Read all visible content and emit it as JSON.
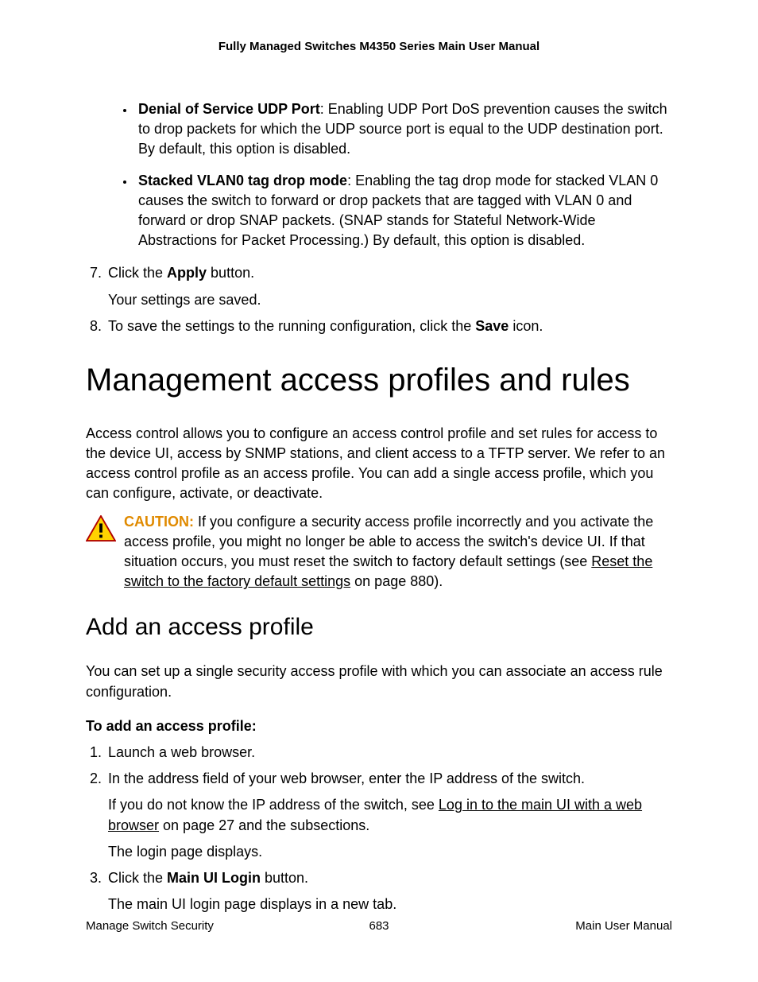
{
  "header_title": "Fully Managed Switches M4350 Series Main User Manual",
  "bullets": [
    {
      "bold": "Denial of Service UDP Port",
      "text": ": Enabling UDP Port DoS prevention causes the switch to drop packets for which the UDP source port is equal to the UDP destination port. By default, this option is disabled."
    },
    {
      "bold": "Stacked VLAN0 tag drop mode",
      "text": ": Enabling the tag drop mode for stacked VLAN 0 causes the switch to forward or drop packets that are tagged with VLAN 0 and forward or drop SNAP packets. (SNAP stands for Stateful Network-Wide Abstractions for Packet Processing.) By default, this option is disabled."
    }
  ],
  "step7": {
    "num": "7.",
    "pre": "Click the ",
    "bold": "Apply",
    "post": " button.",
    "result": "Your settings are saved."
  },
  "step8": {
    "num": "8.",
    "pre": "To save the settings to the running configuration, click the ",
    "bold": "Save",
    "post": " icon."
  },
  "h1": "Management access profiles and rules",
  "intro_para": "Access control allows you to configure an access control profile and set rules for access to the device UI, access by SNMP stations, and client access to a TFTP server. We refer to an access control profile as an access profile. You can add a single access profile, which you can configure, activate, or deactivate.",
  "caution": {
    "label": "CAUTION:",
    "text_pre": " If you configure a security access profile incorrectly and you activate the access profile, you might no longer be able to access the switch's device UI. If that situation occurs, you must reset the switch to factory default settings (see ",
    "link": "Reset the switch to the factory default settings",
    "text_post": " on page 880)."
  },
  "h2": "Add an access profile",
  "h2_intro": "You can set up a single security access profile with which you can associate an access rule configuration.",
  "sub_bold": "To add an access profile:",
  "pstep1": {
    "num": "1.",
    "text": "Launch a web browser."
  },
  "pstep2": {
    "num": "2.",
    "text": "In the address field of your web browser, enter the IP address of the switch.",
    "p2_pre": "If you do not know the IP address of the switch, see ",
    "p2_link": "Log in to the main UI with a web browser",
    "p2_post": " on page 27 and the subsections.",
    "p3": "The login page displays."
  },
  "pstep3": {
    "num": "3.",
    "pre": "Click the ",
    "bold": "Main UI Login",
    "post": " button.",
    "result": "The main UI login page displays in a new tab."
  },
  "footer": {
    "left": "Manage Switch Security",
    "center": "683",
    "right": "Main User Manual"
  }
}
